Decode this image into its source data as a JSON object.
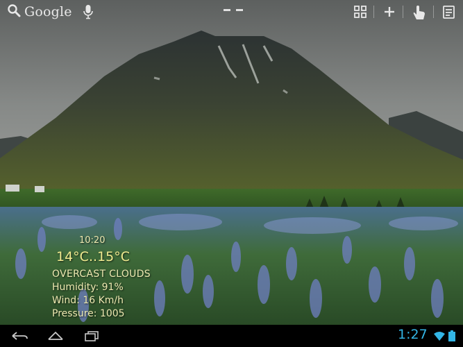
{
  "launcher": {
    "search_label": "Google",
    "search_icon": "search-icon",
    "voice_icon": "microphone-icon",
    "page_indicator_count": 2,
    "toolbar_icons": [
      "apps-grid-icon",
      "add-icon",
      "hand-touch-icon",
      "edit-notes-icon"
    ]
  },
  "weather": {
    "time": "10:20",
    "temperature": "14°C..15°C",
    "condition": "OVERCAST CLOUDS",
    "humidity": "Humidity: 91%",
    "wind": "Wind: 16 Km/h",
    "pressure": "Pressure: 1005"
  },
  "navbar": {
    "buttons": [
      "back-icon",
      "home-icon",
      "recent-apps-icon"
    ]
  },
  "status": {
    "clock": "1:27",
    "icons": [
      "wifi-icon",
      "battery-icon"
    ]
  },
  "colors": {
    "weather_text": "#ece8b0",
    "clock": "#33b5e5"
  }
}
